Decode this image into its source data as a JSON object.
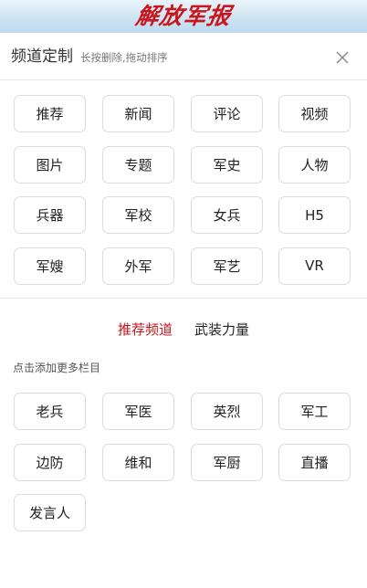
{
  "header": {
    "logo_text": "解放军报"
  },
  "panel": {
    "title": "频道定制",
    "subtitle": "长按删除,拖动排序"
  },
  "my_channels": [
    "推荐",
    "新闻",
    "评论",
    "视频",
    "图片",
    "专题",
    "军史",
    "人物",
    "兵器",
    "军校",
    "女兵",
    "H5",
    "军嫂",
    "外军",
    "军艺",
    "VR"
  ],
  "tabs": [
    {
      "label": "推荐频道",
      "active": true
    },
    {
      "label": "武装力量",
      "active": false
    }
  ],
  "add_hint": "点击添加更多栏目",
  "more_channels": [
    "老兵",
    "军医",
    "英烈",
    "军工",
    "边防",
    "维和",
    "军厨",
    "直播",
    "发言人"
  ],
  "colors": {
    "accent": "#c8161d",
    "chip_border": "#dcdcdc",
    "header_bg": "#cfe4f3"
  }
}
